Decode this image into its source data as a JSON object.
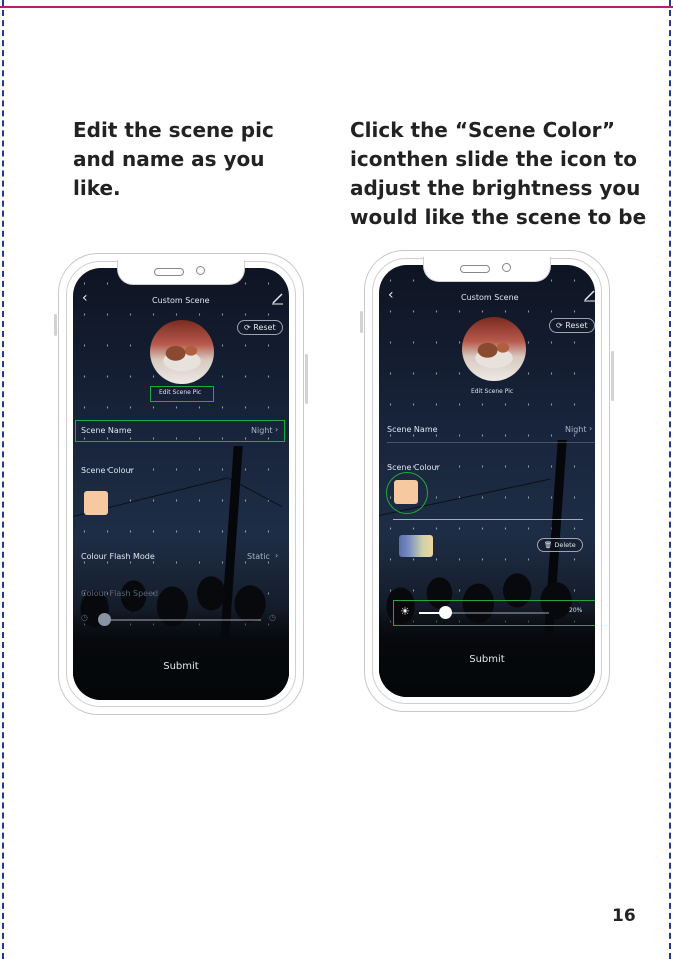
{
  "captions": {
    "left": "Edit the scene pic\nand name as you\nlike.",
    "right": "Click the “Scene Color”\niconthen slide the icon to\nadjust the brightness you\nwould like the scene to be"
  },
  "page_number": "16",
  "phone_left": {
    "title": "Custom Scene",
    "back_icon": "chevron-left-icon",
    "edit_icon": "pen-icon",
    "reset_label": "Reset",
    "edit_pic_label": "Edit Scene Pic",
    "scene_name_label": "Scene Name",
    "scene_name_value": "Night",
    "scene_colour_label": "Scene Colour",
    "swatch_color": "#f6c9a1",
    "flash_mode_label": "Colour Flash Mode",
    "flash_mode_value": "Static",
    "flash_speed_label": "Colour Flash Speed",
    "submit_label": "Submit",
    "highlight_color": "#1faa3a"
  },
  "phone_right": {
    "title": "Custom Scene",
    "reset_label": "Reset",
    "edit_pic_label": "Edit Scene Pic",
    "scene_name_label": "Scene Name",
    "scene_name_value": "Night",
    "scene_colour_label": "Scene Colour",
    "delete_label": "Delete",
    "brightness_value": "20%",
    "brightness_fraction": 0.2,
    "submit_label": "Submit"
  }
}
